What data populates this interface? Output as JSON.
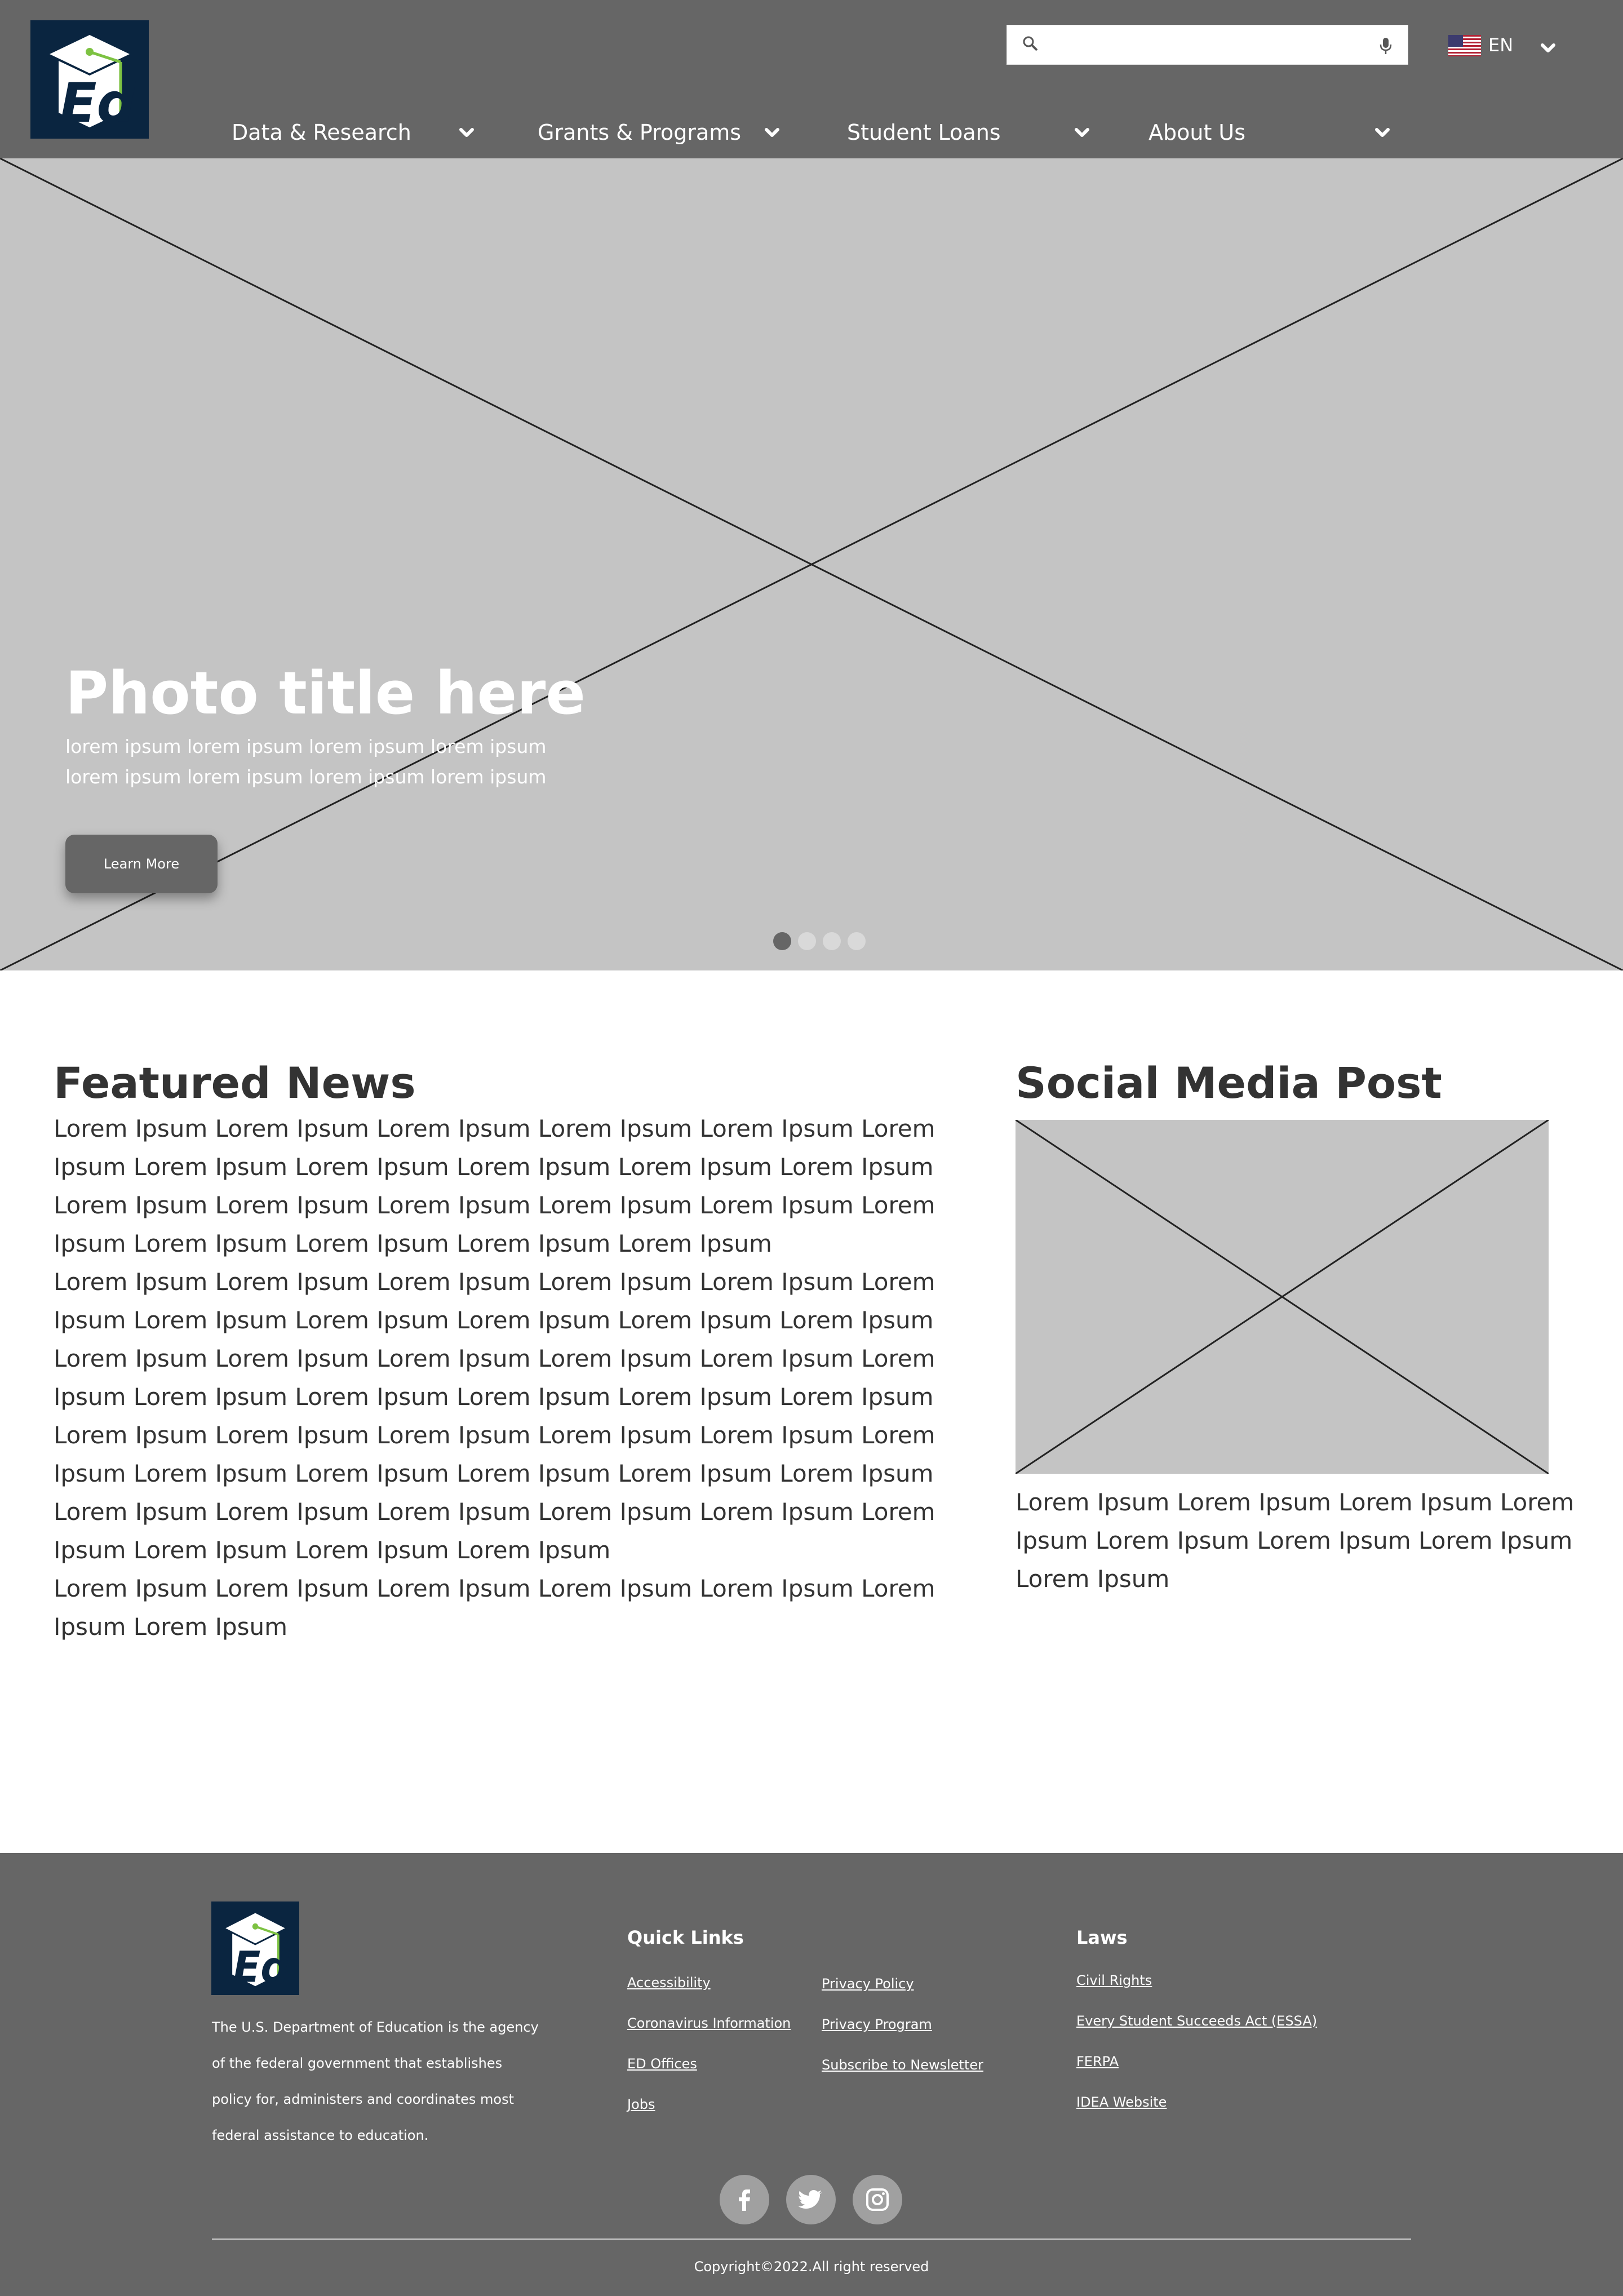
{
  "header": {
    "logo_text": "Ed",
    "search": {
      "placeholder": ""
    },
    "language": {
      "code": "EN"
    },
    "nav": [
      {
        "label": "Data & Research"
      },
      {
        "label": "Grants & Programs"
      },
      {
        "label": "Student Loans"
      },
      {
        "label": "About Us"
      }
    ]
  },
  "hero": {
    "title": "Photo title here",
    "subtitle_lines": [
      "lorem ipsum lorem ipsum lorem ipsum lorem ipsum",
      "lorem ipsum lorem ipsum lorem ipsum lorem ipsum"
    ],
    "button_label": "Learn More",
    "slides": 4,
    "active_slide": 1
  },
  "featured": {
    "title": "Featured News",
    "lines": [
      "Lorem Ipsum Lorem Ipsum Lorem Ipsum Lorem Ipsum Lorem Ipsum Lorem",
      "Ipsum Lorem Ipsum Lorem Ipsum Lorem Ipsum Lorem Ipsum Lorem Ipsum",
      "Lorem Ipsum Lorem Ipsum Lorem Ipsum Lorem Ipsum Lorem Ipsum Lorem",
      "Ipsum Lorem Ipsum Lorem Ipsum Lorem Ipsum Lorem Ipsum",
      "Lorem Ipsum Lorem Ipsum Lorem Ipsum Lorem Ipsum Lorem Ipsum Lorem",
      "Ipsum Lorem Ipsum Lorem Ipsum Lorem Ipsum Lorem Ipsum Lorem Ipsum",
      "Lorem Ipsum Lorem Ipsum Lorem Ipsum Lorem Ipsum Lorem Ipsum Lorem",
      "Ipsum Lorem Ipsum Lorem Ipsum Lorem Ipsum Lorem Ipsum Lorem Ipsum",
      "Lorem Ipsum Lorem Ipsum Lorem Ipsum Lorem Ipsum Lorem Ipsum Lorem",
      "Ipsum Lorem Ipsum Lorem Ipsum Lorem Ipsum Lorem Ipsum Lorem Ipsum",
      "Lorem Ipsum Lorem Ipsum Lorem Ipsum Lorem Ipsum Lorem Ipsum Lorem",
      "Ipsum Lorem Ipsum Lorem Ipsum Lorem Ipsum",
      "Lorem Ipsum Lorem Ipsum Lorem Ipsum Lorem Ipsum Lorem Ipsum Lorem",
      "Ipsum Lorem Ipsum"
    ]
  },
  "social": {
    "title": "Social Media Post",
    "lines": [
      "Lorem Ipsum Lorem Ipsum Lorem Ipsum Lorem",
      "Ipsum Lorem Ipsum Lorem Ipsum Lorem Ipsum",
      "Lorem Ipsum"
    ]
  },
  "footer": {
    "description_lines": [
      "The U.S. Department of Education is the agency",
      "of the federal government that establishes",
      "policy for, administers and coordinates most",
      "federal assistance to education."
    ],
    "quick_links_title": "Quick Links",
    "quick_links_col1": [
      "Accessibility",
      "Coronavirus Information",
      "ED Offices",
      "Jobs"
    ],
    "quick_links_col2": [
      "Privacy Policy",
      "Privacy Program",
      "Subscribe to Newsletter"
    ],
    "laws_title": "Laws",
    "laws": [
      "Civil Rights",
      "Every Student Succeeds Act (ESSA)",
      "FERPA",
      "IDEA Website"
    ],
    "social_icons": [
      "facebook-icon",
      "twitter-icon",
      "instagram-icon"
    ],
    "copyright": "Copyright©2022.All right reserved"
  },
  "colors": {
    "header_bg": "#666666",
    "logo_bg": "#0a2540",
    "logo_accent": "#7dc242",
    "placeholder_gray": "#c4c4c4",
    "footer_bg": "#666666"
  }
}
